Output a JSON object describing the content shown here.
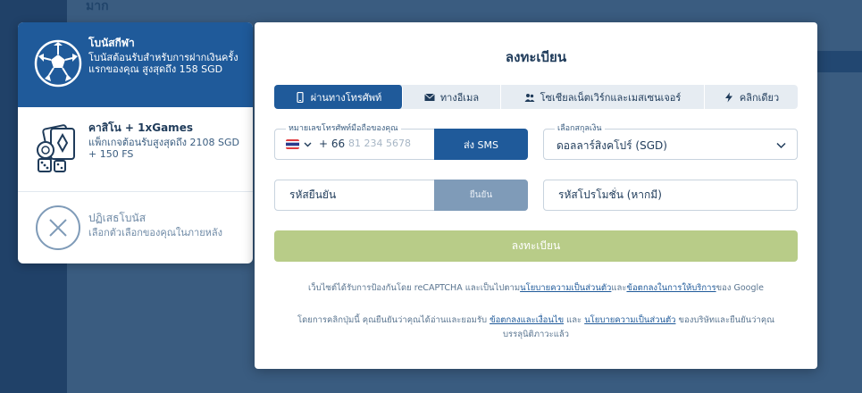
{
  "background": {
    "title": "มาก"
  },
  "bonuses": [
    {
      "title": "โบนัสกีฬา",
      "desc": "โบนัสต้อนรับสำหรับการฝากเงินครั้งแรกของคุณ สูงสุดถึง 158 SGD"
    },
    {
      "title": "คาสิโน + 1xGames",
      "desc": "แพ็กเกจต้อนรับสูงสุดถึง 2108 SGD + 150 FS"
    },
    {
      "title": "ปฏิเสธโบนัส",
      "desc": "เลือกตัวเลือกของคุณในภายหลัง"
    }
  ],
  "modal": {
    "title": "ลงทะเบียน",
    "tabs": [
      {
        "label": "ผ่านทางโทรศัพท์",
        "icon": "phone-icon"
      },
      {
        "label": "ทางอีเมล",
        "icon": "envelope-icon"
      },
      {
        "label": "โซเชียลเน็ตเวิร์กและเมสเซนเจอร์",
        "icon": "users-icon"
      },
      {
        "label": "คลิกเดียว",
        "icon": "lightning-icon"
      }
    ],
    "phone": {
      "label": "หมายเลขโทรศัพท์มือถือของคุณ",
      "code": "+ 66",
      "placeholder": "81 234 5678",
      "sms_label": "ส่ง SMS"
    },
    "currency": {
      "label": "เลือกสกุลเงิน",
      "value": "ดอลลาร์สิงคโปร์ (SGD)"
    },
    "confirm_code": {
      "placeholder": "รหัสยืนยัน",
      "button": "ยืนยัน"
    },
    "promo": {
      "placeholder": "รหัสโปรโมชั่น (หากมี)"
    },
    "register_label": "ลงทะเบียน",
    "recaptcha": {
      "prefix": "เว็บไซต์ได้รับการป้องกันโดย reCAPTCHA และเป็นไปตาม",
      "privacy_link": "นโยบายความเป็นส่วนตัว",
      "and": "และ",
      "terms_link": "ข้อตกลงในการให้บริการ",
      "suffix": "ของ Google"
    },
    "agreement": {
      "prefix": "โดยการคลิกปุ่มนี้ คุณยืนยันว่าคุณได้อ่านและยอมรับ ",
      "terms_link": "ข้อตกลงและเงื่อนไข",
      "and": " และ ",
      "privacy_link": "นโยบายความเป็นส่วนตัว",
      "suffix": " ของบริษัทและยืนยันว่าคุณบรรลุนิติภาวะแล้ว"
    }
  },
  "colors": {
    "primary": "#1f5a9a",
    "register": "#b8cc88",
    "text": "#1f3b5a"
  }
}
